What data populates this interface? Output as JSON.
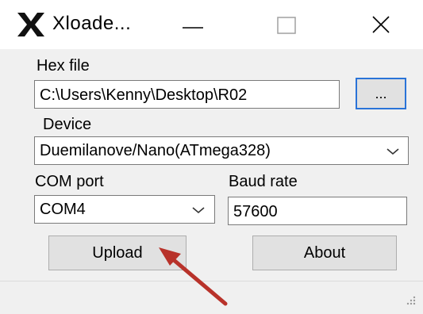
{
  "window": {
    "title": "Xloade...",
    "app_icon": "x-logo-icon",
    "controls": [
      "minimize-icon",
      "maximize-icon",
      "close-icon"
    ]
  },
  "hex_file": {
    "label": "Hex file",
    "value": "C:\\Users\\Kenny\\Desktop\\R02",
    "browse_label": "..."
  },
  "device": {
    "label": "Device",
    "selected": "Duemilanove/Nano(ATmega328)"
  },
  "com_port": {
    "label": "COM port",
    "selected": "COM4"
  },
  "baud_rate": {
    "label": "Baud rate",
    "value": "57600"
  },
  "buttons": {
    "upload": "Upload",
    "about": "About"
  },
  "colors": {
    "focus_border": "#2a73d8",
    "annotation_arrow": "#c0392b"
  }
}
